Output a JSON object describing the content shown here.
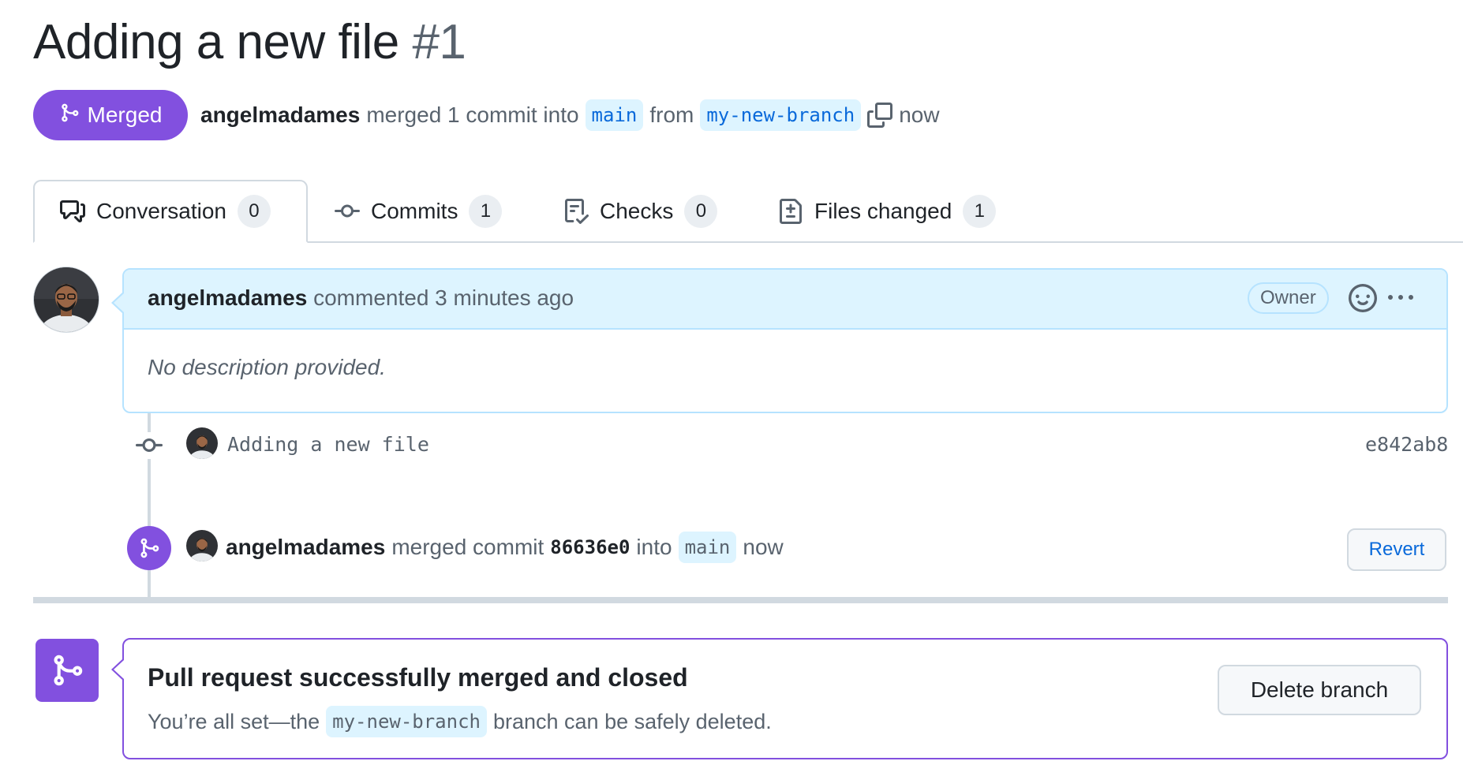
{
  "pr": {
    "title": "Adding a new file",
    "number": "#1",
    "state_label": "Merged",
    "author": "angelmadames",
    "merge_text": "merged 1 commit into",
    "base_branch": "main",
    "from_text": "from",
    "head_branch": "my-new-branch",
    "time": "now"
  },
  "tabs": [
    {
      "label": "Conversation",
      "count": "0",
      "icon": "comment-discussion-icon"
    },
    {
      "label": "Commits",
      "count": "1",
      "icon": "git-commit-icon"
    },
    {
      "label": "Checks",
      "count": "0",
      "icon": "checklist-icon"
    },
    {
      "label": "Files changed",
      "count": "1",
      "icon": "file-diff-icon"
    }
  ],
  "comment": {
    "author": "angelmadames",
    "action": "commented 3 minutes ago",
    "role_badge": "Owner",
    "body": "No description provided."
  },
  "commit": {
    "message": "Adding a new file",
    "sha": "e842ab8"
  },
  "merge_event": {
    "author": "angelmadames",
    "text1": "merged commit",
    "commit": "86636e0",
    "text2": "into",
    "branch": "main",
    "time": "now",
    "revert_label": "Revert"
  },
  "merged_box": {
    "title": "Pull request successfully merged and closed",
    "desc_prefix": "You’re all set—the",
    "branch": "my-new-branch",
    "desc_suffix": "branch can be safely deleted.",
    "delete_label": "Delete branch"
  },
  "colors": {
    "merged_purple": "#8250df",
    "link_blue": "#0969da",
    "comment_header_bg": "#ddf4ff"
  }
}
